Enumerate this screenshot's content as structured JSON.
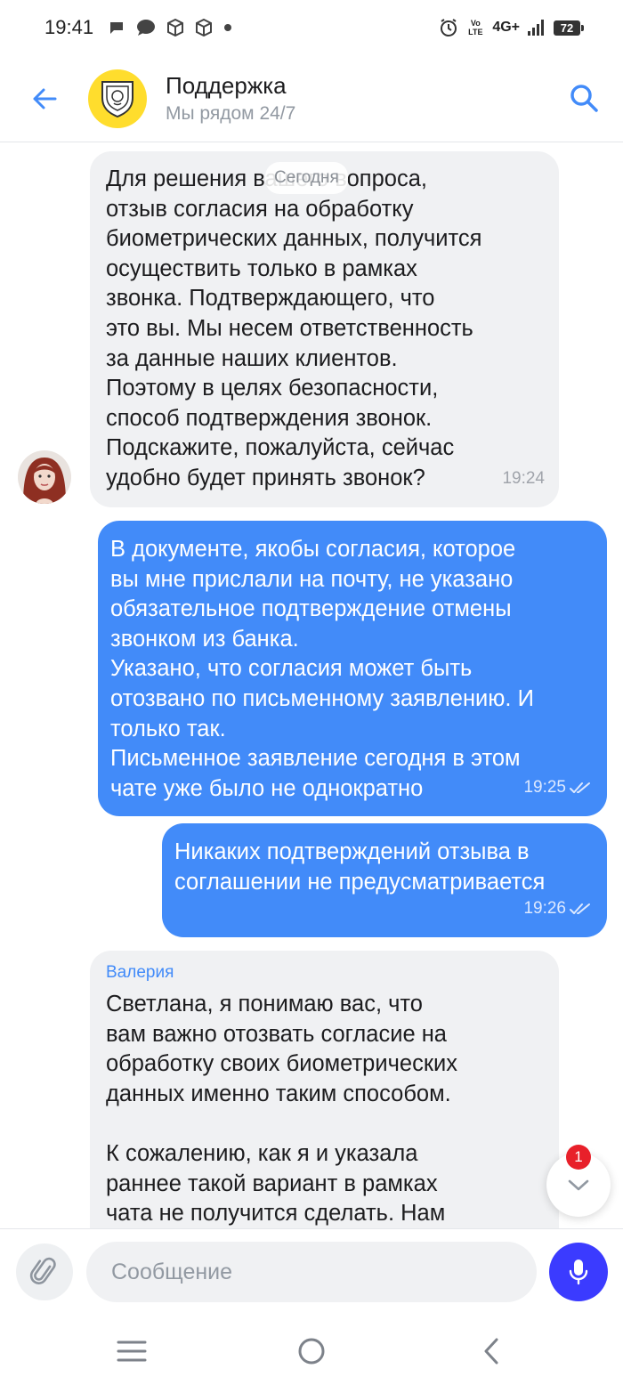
{
  "status_bar": {
    "time": "19:41",
    "network": "4G+",
    "volte": "Vo LTE",
    "battery": "72"
  },
  "header": {
    "title": "Поддержка",
    "subtitle": "Мы рядом 24/7"
  },
  "chat": {
    "date_chip": "Сегодня",
    "messages": [
      {
        "direction": "incoming",
        "text": "Для решения вашего вопроса,\nотзыв согласия на обработку\nбиометрических данных, получится\nосуществить только в рамках\nзвонка. Подтверждающего, что\nэто вы. Мы несем ответственность\nза данные наших клиентов.\nПоэтому в целях безопасности,\nспособ подтверждения звонок.\nПодскажите, пожалуйста, сейчас\nудобно будет принять звонок?",
        "time": "19:24"
      },
      {
        "direction": "outgoing",
        "text": "В документе, якобы согласия, которое\nвы мне прислали на почту, не указано\nобязательное подтверждение отмены\nзвонком из банка.\nУказано, что согласия может быть\nотозвано по письменному заявлению. И\nтолько так.\nПисьменное заявление сегодня в этом\nчате уже было не однократно",
        "time": "19:25"
      },
      {
        "direction": "outgoing",
        "text": "Никаких подтверждений отзыва в\nсоглашении не предусматривается",
        "time": "19:26"
      },
      {
        "direction": "incoming",
        "sender": "Валерия",
        "text": "Светлана, я понимаю вас, что\nвам важно отозвать согласие на\nобработку своих биометрических\nданных именно таким способом.\n\nК сожалению, как я и указала\nраннее такой вариант в рамках\nчата не получится сделать. Нам",
        "time": ""
      }
    ],
    "unread_count": "1"
  },
  "composer": {
    "placeholder": "Сообщение"
  },
  "colors": {
    "accent": "#428bf9",
    "incoming_bubble": "#f0f1f3",
    "mic_button": "#3b3bff",
    "logo_yellow": "#ffdd2d",
    "badge_red": "#e8202a"
  }
}
